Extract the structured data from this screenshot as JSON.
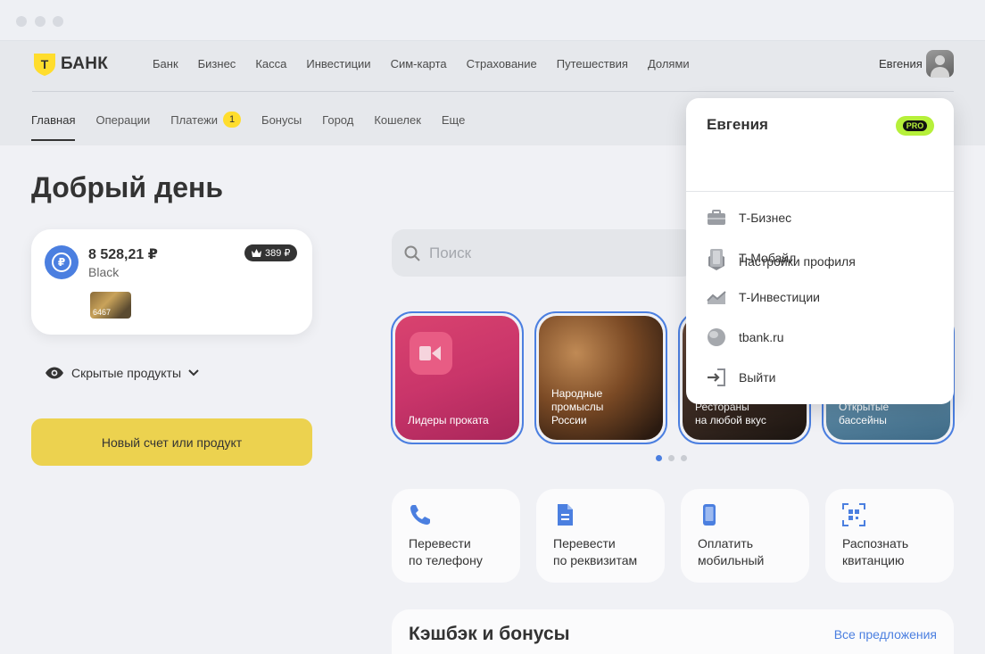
{
  "brand": {
    "name": "БАНК",
    "logo_letter": "Т"
  },
  "top_nav": [
    "Банк",
    "Бизнес",
    "Касса",
    "Инвестиции",
    "Сим-карта",
    "Страхование",
    "Путешествия",
    "Долями"
  ],
  "user": {
    "name": "Евгения"
  },
  "sub_nav": [
    {
      "label": "Главная",
      "active": true
    },
    {
      "label": "Операции"
    },
    {
      "label": "Платежи",
      "badge": "1"
    },
    {
      "label": "Бонусы"
    },
    {
      "label": "Город"
    },
    {
      "label": "Кошелек"
    },
    {
      "label": "Еще"
    }
  ],
  "greeting": "Добрый день",
  "account": {
    "amount": "8 528,21 ₽",
    "type": "Black",
    "cashback": "389 ₽",
    "card_last4": "6467"
  },
  "hidden_products": "Скрытые продукты",
  "new_product": "Новый счет или продукт",
  "search": {
    "placeholder": "Поиск"
  },
  "stories": [
    {
      "label": "Лидеры проката"
    },
    {
      "label": "Народные\nпромыслы\nРоссии"
    },
    {
      "label": "Рестораны\nна любой вкус"
    },
    {
      "label": "Открытые\nбассейны"
    }
  ],
  "actions": [
    {
      "label": "Перевести\nпо телефону",
      "icon": "phone-icon"
    },
    {
      "label": "Перевести\nпо реквизитам",
      "icon": "document-icon"
    },
    {
      "label": "Оплатить\nмобильный",
      "icon": "mobile-icon"
    },
    {
      "label": "Распознать\nквитанцию",
      "icon": "qr-scan-icon"
    }
  ],
  "cashback": {
    "title": "Кэшбэк и бонусы",
    "all_link": "Все предложения"
  },
  "dropdown": {
    "name": "Евгения",
    "pro_label": "PRO",
    "settings": "Настройки профиля",
    "items": [
      "Т-Бизнес",
      "Т-Мобайл",
      "Т-Инвестиции",
      "tbank.ru",
      "Выйти"
    ]
  },
  "colors": {
    "brand_yellow": "#ffdd2d",
    "accent_blue": "#4b7fe0",
    "pro_green": "#b6f03a"
  }
}
